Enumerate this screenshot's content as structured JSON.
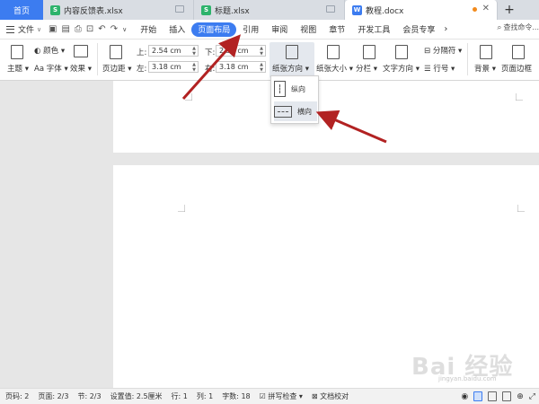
{
  "tabs": {
    "home": "首页",
    "docs": [
      {
        "name": "内容反馈表.xlsx",
        "type": "S"
      },
      {
        "name": "标题.xlsx",
        "type": "S"
      },
      {
        "name": "教程.docx",
        "type": "W"
      }
    ],
    "add": "+"
  },
  "menu": {
    "file_label": "文件",
    "items": [
      "开始",
      "插入",
      "页面布局",
      "引用",
      "审阅",
      "视图",
      "章节",
      "开发工具",
      "会员专享"
    ],
    "active": "页面布局",
    "search": "查找命令..."
  },
  "ribbon": {
    "theme": "主题",
    "color": "颜色",
    "font": "字体",
    "effect": "效果",
    "margins": "页边距",
    "top_label": "上:",
    "top_value": "2.54 cm",
    "bottom_label": "下:",
    "bottom_value": "2.54 cm",
    "left_label": "左:",
    "left_value": "3.18 cm",
    "right_label": "右:",
    "right_value": "3.18 cm",
    "orientation": "纸张方向",
    "size": "纸张大小",
    "columns": "分栏",
    "text_direction": "文字方向",
    "separator": "分隔符",
    "line_number": "行号",
    "background": "背景",
    "page_border": "页面边框"
  },
  "dropdown": {
    "portrait": "纵向",
    "landscape": "横向"
  },
  "status": {
    "page_number": "页码: 2",
    "pages": "页面: 2/3",
    "section": "节: 2/3",
    "setting": "设置值: 2.5厘米",
    "row": "行: 1",
    "col": "列: 1",
    "wordcount": "字数: 18",
    "spellcheck": "拼写检查",
    "proofread": "文档校对"
  },
  "colors": {
    "accent": "#3c7cf0",
    "arrow": "#b22222"
  },
  "watermark": {
    "text": "Bai 经验",
    "url": "jingyan.baidu.com"
  }
}
